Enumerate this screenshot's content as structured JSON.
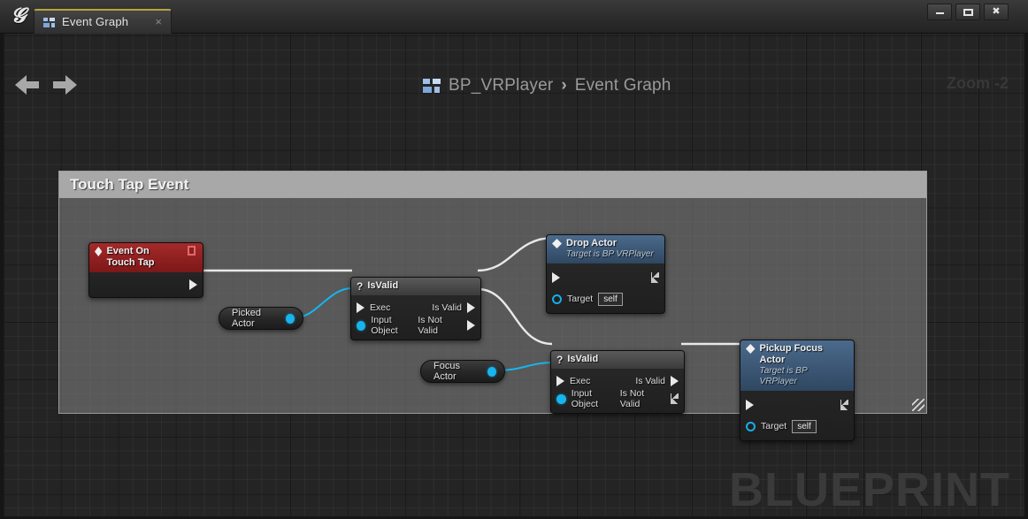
{
  "window": {
    "app_logo": "unreal-logo",
    "controls": {
      "minimize": "minimize",
      "maximize": "maximize",
      "close": "close"
    }
  },
  "tab": {
    "label": "Event Graph",
    "icon": "blueprint-icon",
    "close": "×"
  },
  "toolbar": {
    "back": "back-arrow",
    "forward": "forward-arrow",
    "breadcrumb": {
      "icon": "blueprint-icon",
      "root": "BP_VRPlayer",
      "separator": "›",
      "current": "Event Graph"
    },
    "zoom_label": "Zoom -2"
  },
  "canvas": {
    "watermark": "BLUEPRINT",
    "comment": {
      "title": "Touch Tap Event"
    }
  },
  "nodes": {
    "event": {
      "title": "Event On Touch Tap",
      "icon": "event-diamond-icon",
      "delegate_pin": "delegate-pin",
      "out_exec": "exec-out-pin"
    },
    "isvalid1": {
      "title": "IsValid",
      "icon": "question-mark-icon",
      "in_exec": "Exec",
      "in_object": "Input Object",
      "out_valid": "Is Valid",
      "out_not_valid": "Is Not Valid"
    },
    "isvalid2": {
      "title": "IsValid",
      "icon": "question-mark-icon",
      "in_exec": "Exec",
      "in_object": "Input Object",
      "out_valid": "Is Valid",
      "out_not_valid": "Is Not Valid"
    },
    "drop_actor": {
      "title": "Drop Actor",
      "subtitle": "Target is BP VRPlayer",
      "icon": "function-diamond-icon",
      "target_label": "Target",
      "target_value": "self"
    },
    "pickup_focus_actor": {
      "title": "Pickup Focus Actor",
      "subtitle": "Target is BP VRPlayer",
      "icon": "function-diamond-icon",
      "target_label": "Target",
      "target_value": "self"
    },
    "picked_actor": {
      "label": "Picked Actor",
      "pin": "object-out-pin"
    },
    "focus_actor": {
      "label": "Focus Actor",
      "pin": "object-out-pin"
    }
  },
  "colors": {
    "accent_tab": "#b9a43c",
    "event_node_header": "#8d1f1f",
    "function_node_header": "#3c5a78",
    "pure_node_header": "#4a4a4a",
    "object_pin": "#16b5f0",
    "exec_wire": "#e8e8e8",
    "canvas_bg": "#242424",
    "comment_fill": "#7d7d7d"
  }
}
